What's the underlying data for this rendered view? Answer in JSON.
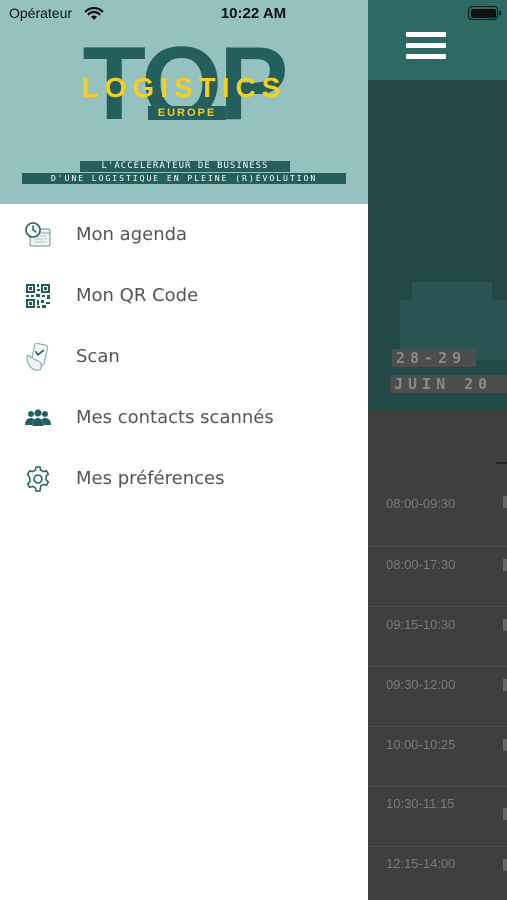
{
  "status_bar": {
    "carrier": "Opérateur",
    "time": "10:22 AM"
  },
  "colors": {
    "brand_teal": "#245f5d",
    "header_teal_light": "#95c2bf",
    "brand_yellow": "#f2cf22",
    "app_bar": "#2f6964"
  },
  "drawer": {
    "logo": {
      "top": "TOP",
      "logistics": "LOGISTICS",
      "europe": "EUROPE"
    },
    "tagline": [
      "L'ACCÉLÉRATEUR DE BUSINESS",
      "D'UNE LOGISTIQUE EN PLEINE (R)ÉVOLUTION"
    ],
    "menu": [
      {
        "label": "Mon agenda",
        "icon": "calendar-clock-icon"
      },
      {
        "label": "Mon QR Code",
        "icon": "qr-code-icon"
      },
      {
        "label": "Scan",
        "icon": "scan-hand-icon"
      },
      {
        "label": "Mes contacts scannés",
        "icon": "contacts-group-icon"
      },
      {
        "label": "Mes préférences",
        "icon": "gear-icon"
      }
    ]
  },
  "background": {
    "hero_dates": [
      "28-29",
      "JUIN 20"
    ],
    "schedule_times": [
      "08:00-09:30",
      "08:00-17:30",
      "09:15-10:30",
      "09:30-12:00",
      "10:00-10:25",
      "10:30-11:15",
      "12:15-14:00"
    ]
  }
}
